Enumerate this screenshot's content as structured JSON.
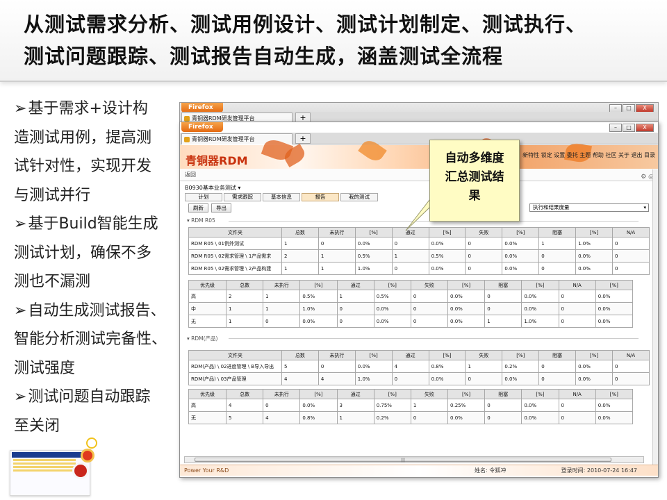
{
  "slide": {
    "title_lines": [
      "从测试需求分析、测试用例设计、测试计划制定、测试执行、",
      "测试问题跟踪、测试报告自动生成，涵盖测试全流程"
    ],
    "bullet_lines": [
      {
        "arrow": "➢",
        "text": "基于需求+设计构"
      },
      {
        "arrow": "",
        "text": "造测试用例，提高测"
      },
      {
        "arrow": "",
        "text": "试针对性，实现开发"
      },
      {
        "arrow": "",
        "text": "与测试并行"
      },
      {
        "arrow": "➢",
        "text": "基于Build智能生成"
      },
      {
        "arrow": "",
        "text": "测试计划，确保不多"
      },
      {
        "arrow": "",
        "text": "测也不漏测"
      },
      {
        "arrow": "➢",
        "text": "自动生成测试报告、"
      },
      {
        "arrow": "",
        "text": "智能分析测试完备性、"
      },
      {
        "arrow": "",
        "text": "测试强度"
      },
      {
        "arrow": "➢",
        "text": "测试问题自动跟踪"
      },
      {
        "arrow": "",
        "text": "至关闭"
      }
    ],
    "callout_lines": [
      "自动多维度",
      "汇总测试结",
      "果"
    ]
  },
  "browser": {
    "firefox_label": "Firefox",
    "tab_title": "青铜器RDM研发管理平台",
    "tab_plus": "+",
    "ctrl": {
      "min": "–",
      "max": "□",
      "close": "X"
    }
  },
  "app": {
    "brand": "青铜器RDM",
    "topnav": "新特性  锁定  设置  委托  主题  帮助  社区  关于  退出  目录",
    "back": "返回",
    "project": "B0930基本业务测试  ▾",
    "tabs": [
      "计划",
      "需求跟踪",
      "基本信息",
      "报告",
      "我的测试"
    ],
    "active_tab": "报告",
    "buttons": [
      "刷新",
      "导出"
    ],
    "select_value": "执行和结果度量",
    "section1": "▾  RDM R05",
    "section2": "▾  RDM(产品)",
    "status": {
      "left": "Power Your R&D",
      "mid": "姓名: 令狐冲",
      "right": "登录时间: 2010-07-24 16:47"
    }
  },
  "tables": {
    "t1": {
      "headers": [
        "文件夹",
        "总数",
        "未执行",
        "[%]",
        "通过",
        "[%]",
        "失败",
        "[%]",
        "阻塞",
        "[%]",
        "N/A"
      ],
      "rows": [
        [
          "RDM R05 \\ 01例外测试",
          "1",
          "0",
          "0.0%",
          "0",
          "0.0%",
          "0",
          "0.0%",
          "1",
          "1.0%",
          "0"
        ],
        [
          "RDM R05 \\ 02需求管理 \\ 1产品需求",
          "2",
          "1",
          "0.5%",
          "1",
          "0.5%",
          "0",
          "0.0%",
          "0",
          "0.0%",
          "0"
        ],
        [
          "RDM R05 \\ 02需求管理 \\ 2产品构建",
          "1",
          "1",
          "1.0%",
          "0",
          "0.0%",
          "0",
          "0.0%",
          "0",
          "0.0%",
          "0"
        ]
      ]
    },
    "t2": {
      "headers": [
        "优先级",
        "总数",
        "未执行",
        "[%]",
        "通过",
        "[%]",
        "失败",
        "[%]",
        "阻塞",
        "[%]",
        "N/A",
        "[%]"
      ],
      "rows": [
        [
          "高",
          "2",
          "1",
          "0.5%",
          "1",
          "0.5%",
          "0",
          "0.0%",
          "0",
          "0.0%",
          "0",
          "0.0%"
        ],
        [
          "中",
          "1",
          "1",
          "1.0%",
          "0",
          "0.0%",
          "0",
          "0.0%",
          "0",
          "0.0%",
          "0",
          "0.0%"
        ],
        [
          "无",
          "1",
          "0",
          "0.0%",
          "0",
          "0.0%",
          "0",
          "0.0%",
          "1",
          "1.0%",
          "0",
          "0.0%"
        ]
      ]
    },
    "t3": {
      "headers": [
        "文件夹",
        "总数",
        "未执行",
        "[%]",
        "通过",
        "[%]",
        "失败",
        "[%]",
        "阻塞",
        "[%]",
        "N/A"
      ],
      "rows": [
        [
          "RDM(产品) \\ 02进度管理 \\ B导入导出",
          "5",
          "0",
          "0.0%",
          "4",
          "0.8%",
          "1",
          "0.2%",
          "0",
          "0.0%",
          "0"
        ],
        [
          "RDM(产品) \\ 03产品管理",
          "4",
          "4",
          "1.0%",
          "0",
          "0.0%",
          "0",
          "0.0%",
          "0",
          "0.0%",
          "0"
        ]
      ]
    },
    "t4": {
      "headers": [
        "优先级",
        "总数",
        "未执行",
        "[%]",
        "通过",
        "[%]",
        "失败",
        "[%]",
        "阻塞",
        "[%]",
        "N/A",
        "[%]"
      ],
      "rows": [
        [
          "高",
          "4",
          "0",
          "0.0%",
          "3",
          "0.75%",
          "1",
          "0.25%",
          "0",
          "0.0%",
          "0",
          "0.0%"
        ],
        [
          "无",
          "5",
          "4",
          "0.8%",
          "1",
          "0.2%",
          "0",
          "0.0%",
          "0",
          "0.0%",
          "0",
          "0.0%"
        ]
      ]
    }
  }
}
